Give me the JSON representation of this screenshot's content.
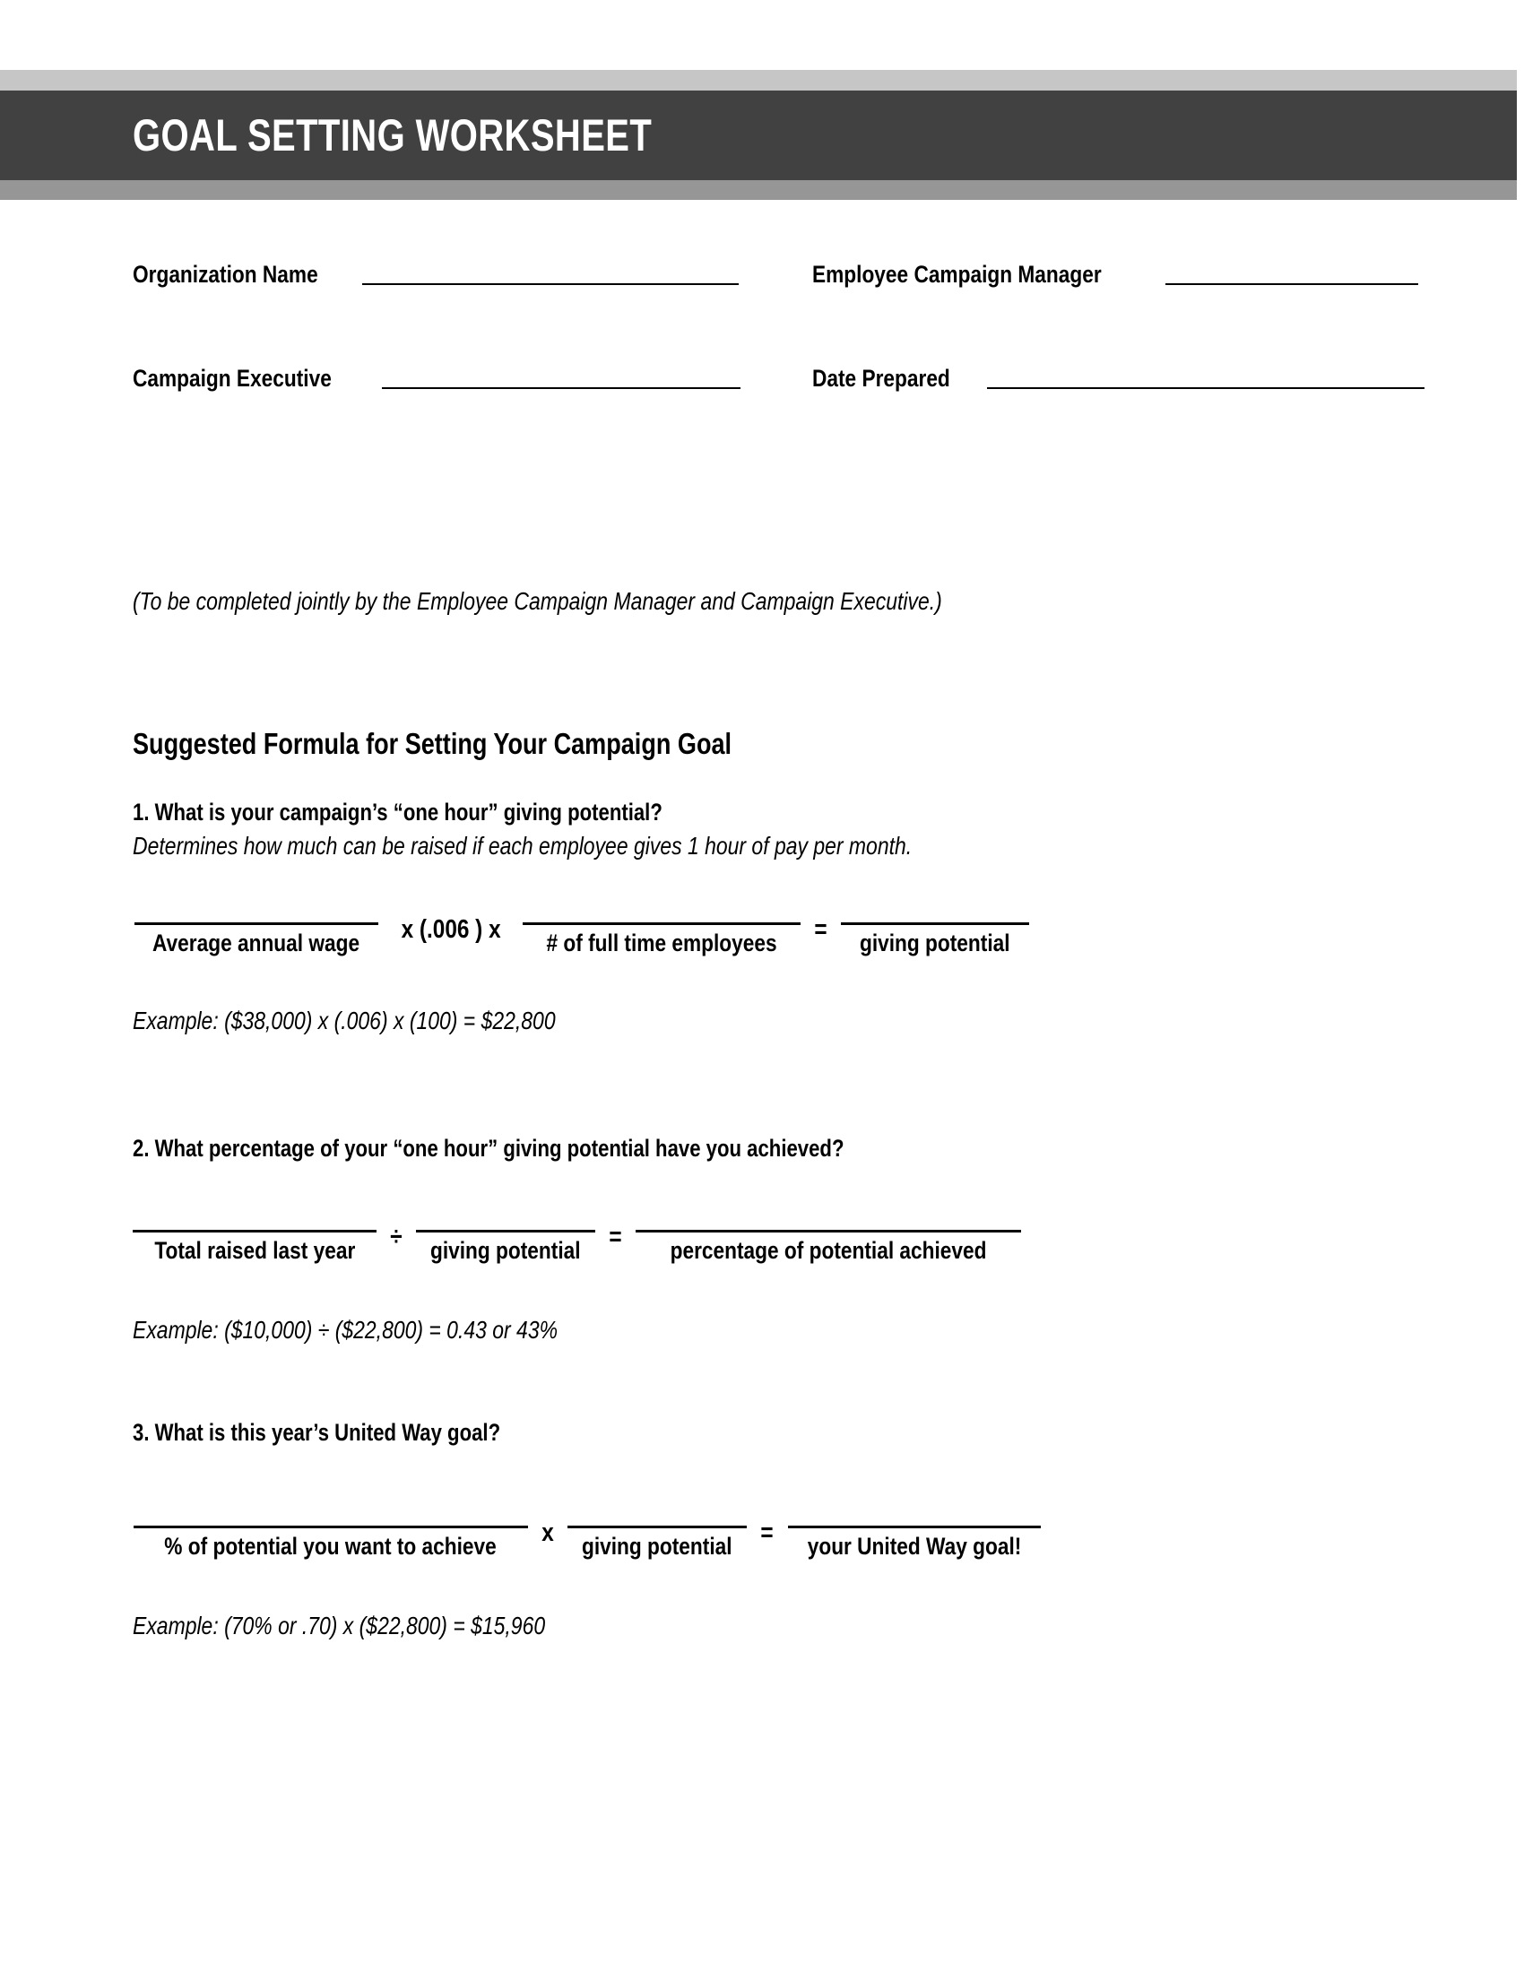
{
  "header": {
    "title": "GOAL SETTING WORKSHEET",
    "bar_light_color": "#c6c6c6",
    "bar_dark_color": "#414141",
    "bar_mid_color": "#969696",
    "title_color": "#ffffff"
  },
  "form": {
    "organization_name_label": "Organization Name",
    "organization_name_value": "",
    "employee_campaign_manager_label": "Employee Campaign Manager",
    "employee_campaign_manager_value": "",
    "campaign_executive_label": "Campaign Executive",
    "campaign_executive_value": "",
    "date_prepared_label": "Date Prepared",
    "date_prepared_value": ""
  },
  "jointly_note": "(To be completed jointly by the Employee Campaign Manager and Campaign Executive.)",
  "section_heading": "Suggested Formula for Setting Your Campaign Goal",
  "questions": [
    {
      "title": "1. What is your campaign’s “one hour” giving potential?",
      "subtitle": "Determines how much can be raised if each employee gives 1 hour of pay per month.",
      "formula": {
        "slot_a_caption": "Average annual wage",
        "op_1": "x (.006 ) x",
        "slot_b_caption": "# of full time employees",
        "op_2": "=",
        "slot_c_caption": "giving potential"
      },
      "example": "Example: ($38,000) x (.006) x (100) = $22,800"
    },
    {
      "title": "2. What percentage of your “one hour” giving potential have you achieved?",
      "subtitle": "",
      "formula": {
        "slot_a_caption": "Total raised last year",
        "op_1": "÷",
        "slot_b_caption": "giving potential",
        "op_2": "=",
        "slot_c_caption": "percentage of potential achieved"
      },
      "example": "Example: ($10,000) ÷ ($22,800) = 0.43 or 43%"
    },
    {
      "title": "3. What is this year’s United Way goal?",
      "subtitle": "",
      "formula": {
        "slot_a_caption": "% of potential you want to achieve",
        "op_1": "x",
        "slot_b_caption": "giving potential",
        "op_2": "=",
        "slot_c_caption": "your United Way goal!"
      },
      "example": "Example: (70% or .70) x ($22,800) = $15,960"
    }
  ]
}
